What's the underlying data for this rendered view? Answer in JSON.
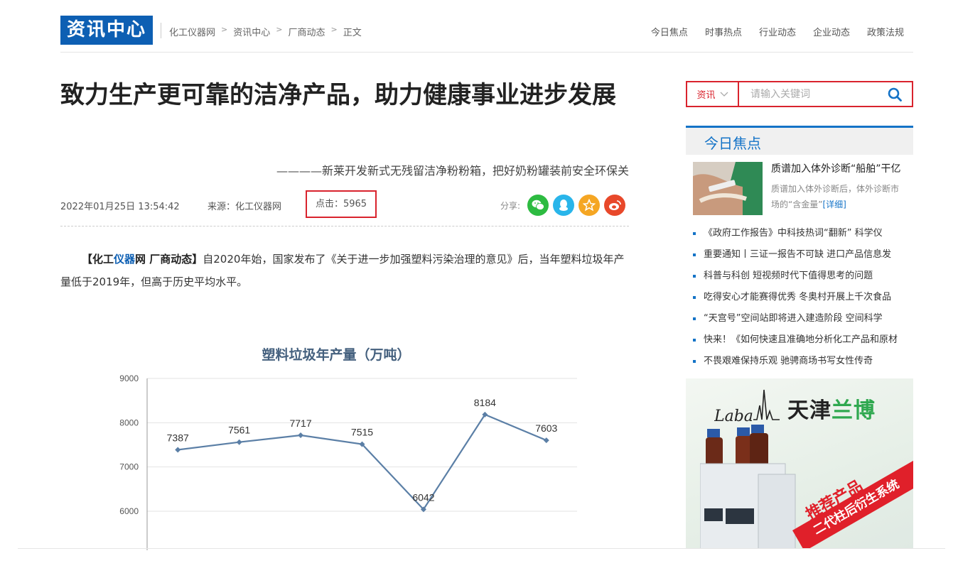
{
  "header": {
    "logo_text": "资讯中心",
    "breadcrumb": [
      "化工仪器网",
      "资讯中心",
      "厂商动态",
      "正文"
    ],
    "breadcrumb_sep": ">",
    "nav": [
      "今日焦点",
      "时事热点",
      "行业动态",
      "企业动态",
      "政策法规"
    ]
  },
  "article": {
    "title": "致力生产更可靠的洁净产品，助力健康事业进步发展",
    "subtitle": "————新莱开发新式无残留洁净粉粉箱，把好奶粉罐装前安全环保关",
    "date": "2022年01月25日 13:54:42",
    "source": "来源：化工仪器网",
    "clicks": "点击：5965",
    "share_label": "分享:",
    "intro_bracket_open": "【化工",
    "intro_link": "仪器",
    "intro_bracket_close": "网 厂商动态】",
    "intro_body": "自2020年始，国家发布了《关于进一步加强塑料污染治理的意见》后，当年塑料垃圾年产量低于2019年，但高于历史平均水平。"
  },
  "chart_data": {
    "type": "line",
    "title": "塑料垃圾年产量（万吨）",
    "values": [
      7387,
      7561,
      7717,
      7515,
      6042,
      8184,
      7603
    ],
    "y_ticks": [
      "9000",
      "8000",
      "7000",
      "6000"
    ],
    "ylim": [
      5200,
      9000
    ],
    "grid": true,
    "color": "#5b7fa6"
  },
  "sidebar": {
    "search": {
      "category": "资讯",
      "placeholder": "请输入关键词"
    },
    "focus_title": "今日焦点",
    "featured": {
      "title": "质谱加入体外诊断“船舶”干亿",
      "desc": "质谱加入体外诊断后，体外诊断市场的“含金量”",
      "more": "[详细]"
    },
    "news": [
      "《政府工作报告》中科技热词“翻新” 科学仪",
      "重要通知丨三证一报告不可缺 进口产品信息发",
      "科普与科创 短视频时代下值得思考的问题",
      "吃得安心才能赛得优秀 冬奥村开展上千次食品",
      "“天宫号”空间站即将进入建造阶段 空间科学",
      "快来！《如何快速且准确地分析化工产品和原材",
      "不畏艰难保持乐观 驰骋商场书写女性传奇"
    ],
    "ad": {
      "logo_text": "Laba",
      "brand_black": "天津",
      "brand_green": "兰博",
      "slogan": "推荐产品",
      "band": "二代柱后衍生系统"
    }
  },
  "colors": {
    "brand_blue": "#0d5fb3",
    "accent_red": "#d9232d",
    "link_blue": "#1473c7"
  }
}
